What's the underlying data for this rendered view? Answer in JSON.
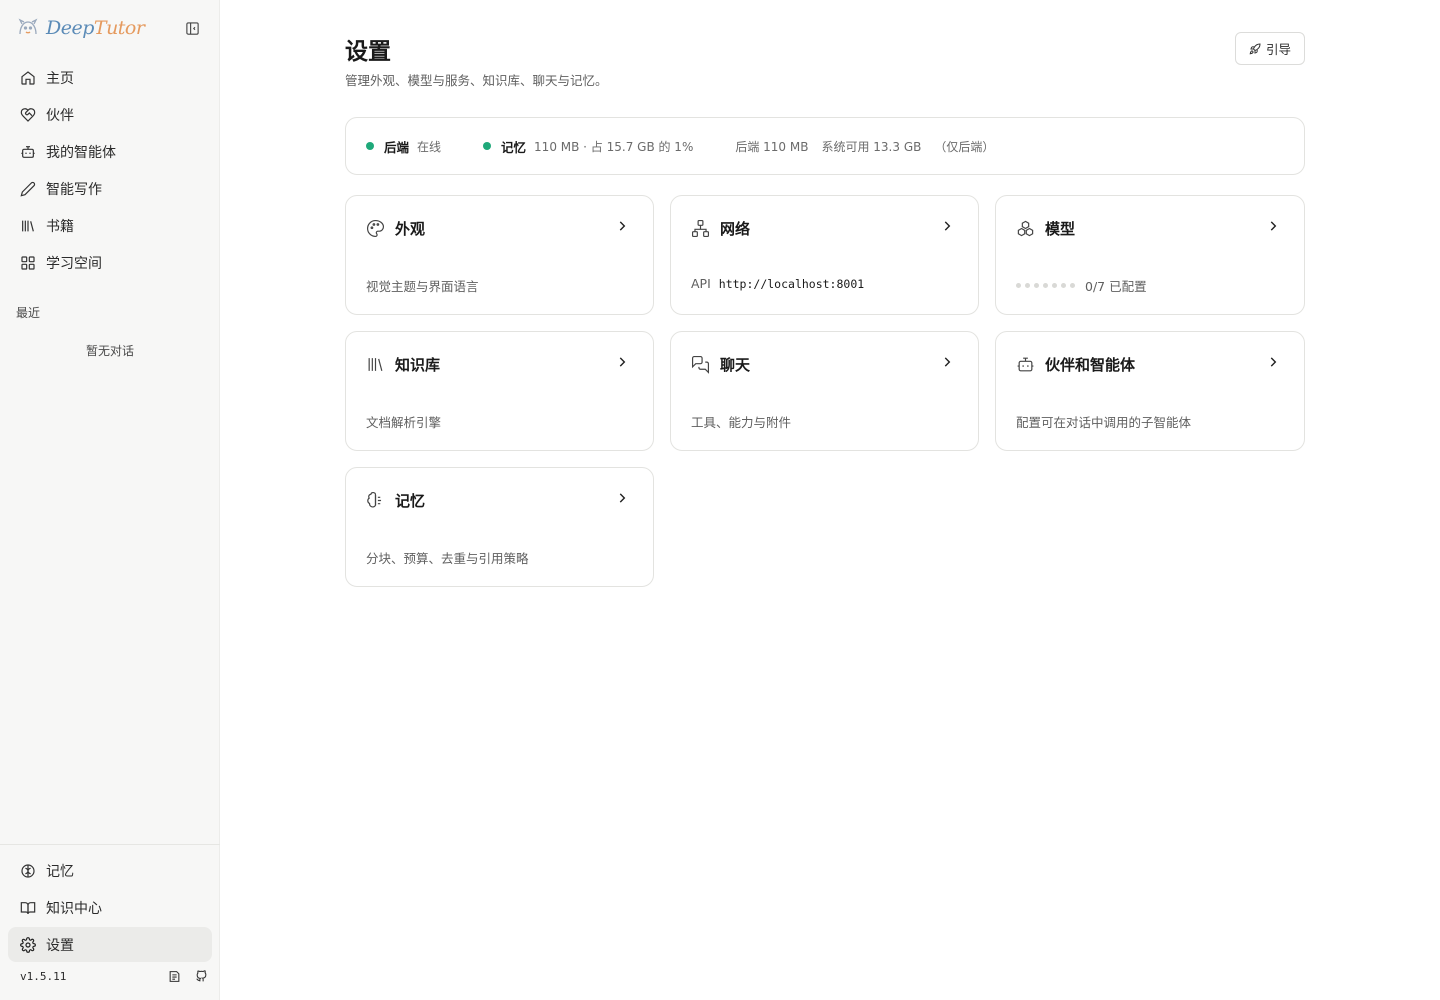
{
  "brand": {
    "part1": "Deep",
    "part2": "Tutor"
  },
  "nav": [
    {
      "label": "主页",
      "icon": "home-icon"
    },
    {
      "label": "伙伴",
      "icon": "heart-handshake-icon"
    },
    {
      "label": "我的智能体",
      "icon": "bot-icon"
    },
    {
      "label": "智能写作",
      "icon": "pen-icon"
    },
    {
      "label": "书籍",
      "icon": "library-icon"
    },
    {
      "label": "学习空间",
      "icon": "grid-icon"
    }
  ],
  "recent": {
    "title": "最近",
    "empty": "暂无对话"
  },
  "bottom_nav": [
    {
      "label": "记忆",
      "icon": "brain-icon"
    },
    {
      "label": "知识中心",
      "icon": "book-open-icon"
    },
    {
      "label": "设置",
      "icon": "gear-icon",
      "active": true
    }
  ],
  "version": "v1.5.11",
  "header": {
    "title": "设置",
    "subtitle": "管理外观、模型与服务、知识库、聊天与记忆。",
    "guide_label": "引导"
  },
  "status": {
    "backend_label": "后端",
    "backend_state": "在线",
    "memory_label": "记忆",
    "memory_detail": "110 MB · 占 15.7 GB 的 1%",
    "backend_usage": "后端 110 MB",
    "system_available": "系统可用 13.3 GB",
    "scope_note": "（仅后端）",
    "status_color": "#1fa97a"
  },
  "cards": {
    "appearance": {
      "title": "外观",
      "desc": "视觉主题与界面语言"
    },
    "network": {
      "title": "网络",
      "api_label": "API",
      "api_url": "http://localhost:8001"
    },
    "models": {
      "title": "模型",
      "configured": "0/7 已配置",
      "configured_count": 0,
      "total": 7
    },
    "knowledge": {
      "title": "知识库",
      "desc": "文档解析引擎"
    },
    "chat": {
      "title": "聊天",
      "desc": "工具、能力与附件"
    },
    "agents": {
      "title": "伙伴和智能体",
      "desc": "配置可在对话中调用的子智能体"
    },
    "memory": {
      "title": "记忆",
      "desc": "分块、预算、去重与引用策略"
    }
  }
}
